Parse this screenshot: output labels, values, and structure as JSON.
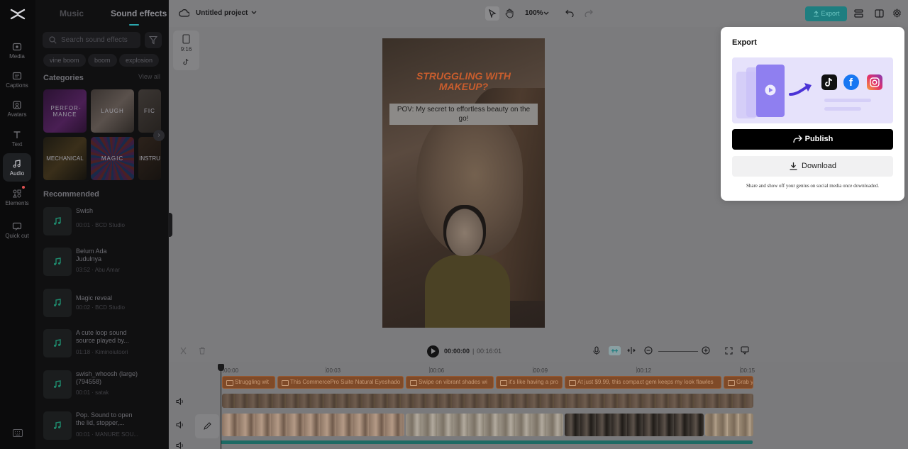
{
  "rail": {
    "items": [
      {
        "label": "Media",
        "icon": "media-icon"
      },
      {
        "label": "Captions",
        "icon": "captions-icon"
      },
      {
        "label": "Avatars",
        "icon": "avatar-icon"
      },
      {
        "label": "Text",
        "icon": "text-icon"
      },
      {
        "label": "Audio",
        "icon": "music-note-icon"
      },
      {
        "label": "Elements",
        "icon": "elements-icon"
      },
      {
        "label": "Quick cut",
        "icon": "quick-cut-icon"
      }
    ]
  },
  "panel": {
    "tabs": [
      "Music",
      "Sound effects"
    ],
    "search_placeholder": "Search sound effects",
    "chips": [
      "vine boom",
      "boom",
      "explosion"
    ],
    "categories_title": "Categories",
    "view_all": "View all",
    "categories": [
      "PERFOR-MANCE",
      "LAUGH",
      "FIC",
      "MECHANICAL",
      "MAGIC",
      "INSTRU"
    ],
    "recommended_title": "Recommended",
    "recommended": [
      {
        "title": "Swish",
        "meta": "00:01 · BCD Studio"
      },
      {
        "title": "Belum Ada Judulnya",
        "meta": "03:52 · Abu Amar"
      },
      {
        "title": "Magic reveal",
        "meta": "00:02 · BCD Studio"
      },
      {
        "title": "A cute loop sound source played by...",
        "meta": "01:18 · Kiminoiutoori"
      },
      {
        "title": "swish_whoosh (large)(794558)",
        "meta": "00:01 · satak"
      },
      {
        "title": "Pop. Sound to open the lid, stopper,...",
        "meta": "00:01 · MANURE SOU..."
      }
    ]
  },
  "topbar": {
    "project_name": "Untitled project",
    "zoom": "100%",
    "export_label": "Export"
  },
  "canvas": {
    "ratio_label": "9:16",
    "overlay_title": "STRUGGLING WITH MAKEUP?",
    "caption": "POV: My secret to effortless beauty on the go!"
  },
  "timeline": {
    "current_time": "00:00:00",
    "separator": "|",
    "total_time": "00:16:01",
    "ruler": [
      "00:00",
      "00:03",
      "00:06",
      "00:09",
      "00:12",
      "00:15"
    ],
    "text_clips": [
      "Struggling wit",
      "This CommercePro Suite Natural Eyeshado",
      "Swipe on vibrant shades wi",
      "it's like having a pro",
      "At just $9.99, this compact gem keeps my look flawles",
      "Grab y"
    ]
  },
  "export_popover": {
    "title": "Export",
    "publish_label": "Publish",
    "download_label": "Download",
    "note": "Share and show off your genius on social media once downloaded."
  },
  "colors": {
    "accent": "#2aa6ad",
    "export_button": "#1e7e80",
    "text_clip": "#7f4a28"
  }
}
